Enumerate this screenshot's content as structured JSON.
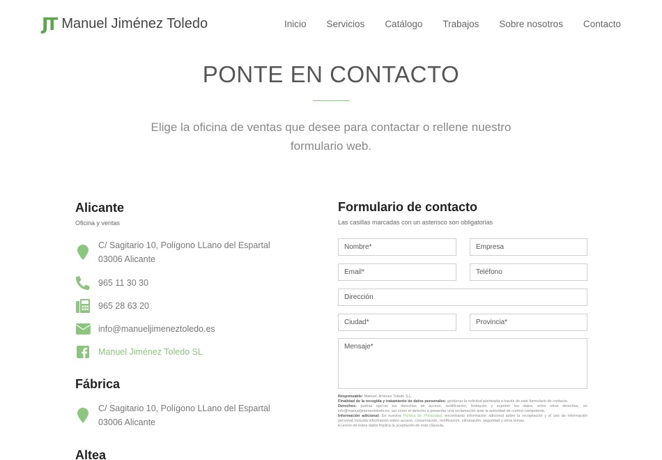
{
  "header": {
    "logo_mark": "JT",
    "logo_name": "Manuel Jiménez Toledo",
    "nav": [
      "Inicio",
      "Servicios",
      "Catálogo",
      "Trabajos",
      "Sobre nosotros",
      "Contacto"
    ]
  },
  "hero": {
    "title": "PONTE EN CONTACTO",
    "subtitle": "Elige la oficina de ventas que desee para contactar o rellene nuestro formulario web."
  },
  "offices": {
    "alicante": {
      "title": "Alicante",
      "subtitle": "Oficina y ventas",
      "address_line1": "C/ Sagitario 10, Polígono LLano del Espartal",
      "address_line2": "03006 Alicante",
      "phone": "965 11 30 30",
      "fax": "965 28 63 20",
      "email": "info@manueljimeneztoledo.es",
      "facebook": "Manuel Jiménez Toledo SL"
    },
    "fabrica": {
      "title": "Fábrica",
      "address_line1": "C/ Sagitario 10, Polígono LLano del Espartal",
      "address_line2": "03006 Alicante"
    },
    "altea": {
      "title": "Altea"
    }
  },
  "form": {
    "title": "Formulario de contacto",
    "subtitle": "Las casillas marcadas con un asterisco son obligatorias",
    "placeholders": {
      "nombre": "Nombre*",
      "empresa": "Empresa",
      "email": "Email*",
      "telefono": "Teléfono",
      "direccion": "Dirección",
      "ciudad": "Ciudad*",
      "provincia": "Provincia*",
      "mensaje": "Mensaje*"
    }
  },
  "legal": {
    "responsable_label": "Responsable:",
    "responsable_text": " Manuel Jiménez Toledo S.L.",
    "finalidad_label": "Finalidad de la recogida y tratamiento de datos personales:",
    "finalidad_text": " gestionar la solicitud planteada a través de este formulario de contacto.",
    "derechos_label": "Derechos:",
    "derechos_text": " podrás ejercer tus derechos de acceso, rectificación, limitación y suprimir los datos, entre otros derechos, en info@manueljimeneztoledo.es, así como el derecho a presentar una reclamación ante la autoridad de control competente.",
    "info_label": "Información adicional:",
    "info_text_1": " En nuestra ",
    "info_link": "Política de Privacidad",
    "info_text_2": ", encontrarás información adicional sobre la recopilación y el uso de información personal, incluida información sobre acceso, conservación, rectificación, eliminación, seguridad y otros temas.",
    "envio_text": "El envío de estos datos implica la aceptación de esta cláusula."
  },
  "colors": {
    "accent": "#8cc57f",
    "logo": "#5ba64e"
  }
}
